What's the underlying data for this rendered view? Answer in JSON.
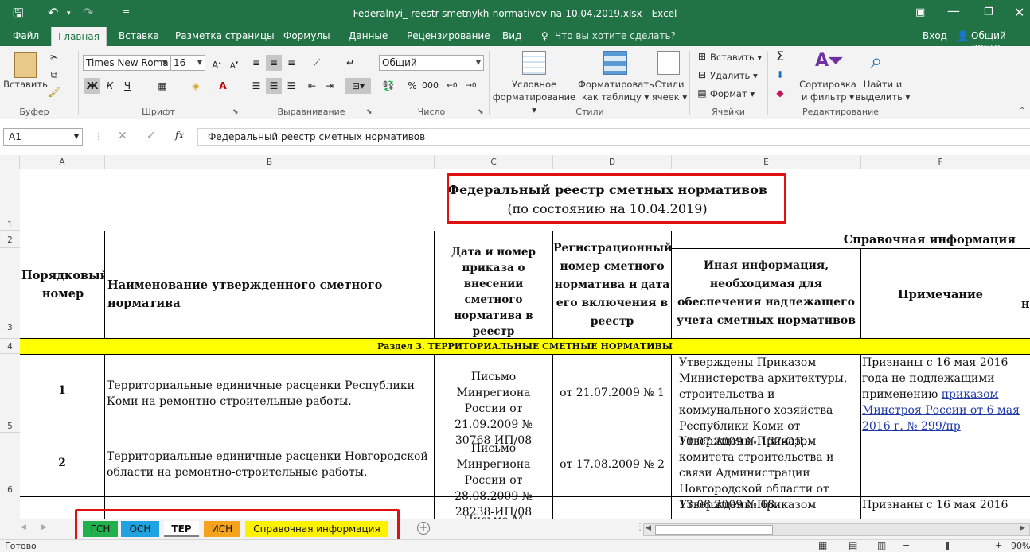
{
  "window": {
    "title": "Federalnyi_-reestr-smetnykh-normativov-na-10.04.2019.xlsx - Excel"
  },
  "ribbon_tabs": [
    "Файл",
    "Главная",
    "Вставка",
    "Разметка страницы",
    "Формулы",
    "Данные",
    "Рецензирование",
    "Вид"
  ],
  "tellme": "Что вы хотите сделать?",
  "signin": "Вход",
  "share": "Общий досту",
  "ribbon": {
    "clipboard": {
      "paste": "Вставить",
      "label": "Буфер обмена"
    },
    "font": {
      "name": "Times New Roma",
      "size": "16",
      "bold": "Ж",
      "italic": "К",
      "underline": "Ч",
      "label": "Шрифт"
    },
    "alignment": {
      "label": "Выравнивание"
    },
    "number": {
      "format": "Общий",
      "label": "Число"
    },
    "styles": {
      "conditional_1": "Условное",
      "conditional_2": "форматирование",
      "as_table_1": "Форматировать",
      "as_table_2": "как таблицу",
      "cell_styles_1": "Стили",
      "cell_styles_2": "ячеек",
      "label": "Стили"
    },
    "cells": {
      "insert": "Вставить",
      "delete": "Удалить",
      "format": "Формат",
      "label": "Ячейки"
    },
    "editing": {
      "sort_1": "Сортировка",
      "sort_2": "и фильтр",
      "find_1": "Найти и",
      "find_2": "выделить",
      "label": "Редактирование"
    }
  },
  "formula_bar": {
    "name_box": "A1",
    "fx": "fx",
    "content": "Федеральный реестр сметных нормативов"
  },
  "columns": [
    "A",
    "B",
    "C",
    "D",
    "E",
    "F"
  ],
  "rows": [
    "1",
    "2",
    "3",
    "4",
    "5",
    "6"
  ],
  "sheet": {
    "title_1": "Федеральный реестр сметных нормативов",
    "title_2": "(по состоянию на 10.04.2019)",
    "ref_info": "Справочная информация",
    "hdr_a": "Порядковый номер",
    "hdr_b": "Наименование утвержденного сметного норматива",
    "hdr_c": "Дата и номер приказа о внесении сметного норматива в реестр",
    "hdr_d": "Регистрационный номер сметного норматива и дата его включения в реестр",
    "hdr_e": "Иная информация, необходимая для обеспечения надлежащего учета сметных нормативов",
    "hdr_f": "Примечание",
    "hdr_g_frag": "н",
    "section": "Раздел 3. ТЕРРИТОРИАЛЬНЫЕ СМЕТНЫЕ НОРМАТИВЫ",
    "r1": {
      "num": "1",
      "name": "Территориальные единичные расценки Республики Коми на ремонтно-строительные работы.",
      "order": "Письмо Минрегиона России от 21.09.2009 № 30768-ИП/08",
      "reg": "от 21.07.2009 № 1",
      "info": "Утверждены Приказом Министерства архитектуры, строительства и коммунального хозяйства Республики Коми от 10.07.2009 № 137-ОД.",
      "note_text": "Признаны с 16 мая 2016 года не подлежащими применению ",
      "note_link": "приказом Минстроя России от 6 мая 2016 г. № 299/пр"
    },
    "r2": {
      "num": "2",
      "name": "Территориальные единичные расценки Новгородской области на ремонтно-строительные работы.",
      "order": "Письмо Минрегиона России от 28.08.2009 № 28238-ИП/08",
      "reg": "от 17.08.2009 № 2",
      "info": "Утверждены Приказом комитета строительства и связи Администрации Новгородской области от 13.08.2009 № 68."
    },
    "r3": {
      "order_frag": "Письмо М",
      "info_frag": "Утверждены Приказом",
      "note_frag": "Признаны с 16 мая 2016"
    }
  },
  "sheet_tabs": [
    {
      "label": "ГСН",
      "color": "#21b04b"
    },
    {
      "label": "ОСН",
      "color": "#1fa3e0"
    },
    {
      "label": "ТЕР",
      "color": "#7f7f7f"
    },
    {
      "label": "ИСН",
      "color": "#f5a21c"
    },
    {
      "label": "Справочная информация",
      "color": "#fff200"
    }
  ],
  "status": {
    "ready": "Готово",
    "zoom": "90%"
  }
}
